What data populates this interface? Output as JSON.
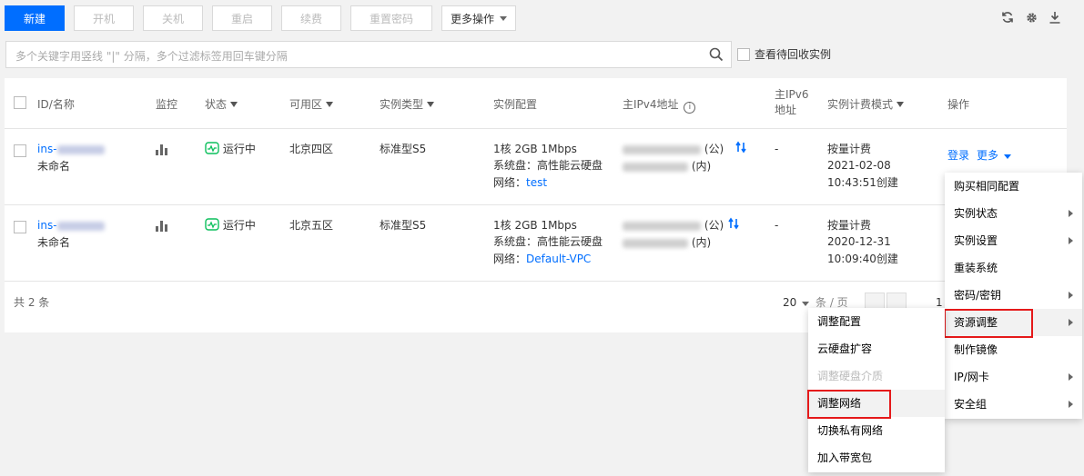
{
  "toolbar": {
    "new_label": "新建",
    "start_label": "开机",
    "stop_label": "关机",
    "restart_label": "重启",
    "renew_label": "续费",
    "reset_password_label": "重置密码",
    "more_actions_label": "更多操作"
  },
  "search": {
    "placeholder": "多个关键字用竖线 \"|\" 分隔，多个过滤标签用回车键分隔",
    "recycle_label": "查看待回收实例"
  },
  "table": {
    "headers": {
      "id_name": "ID/名称",
      "monitor": "监控",
      "status": "状态",
      "zone": "可用区",
      "instance_type": "实例类型",
      "config": "实例配置",
      "ipv4": "主IPv4地址",
      "ipv6_line1": "主IPv6",
      "ipv6_line2": "地址",
      "billing": "实例计费模式",
      "ops": "操作"
    },
    "rows": [
      {
        "id_prefix": "ins-",
        "name": "未命名",
        "status": "运行中",
        "zone": "北京四区",
        "type": "标准型S5",
        "config_spec": "1核 2GB 1Mbps",
        "config_disk": "系统盘：高性能云硬盘",
        "config_network_label": "网络：",
        "config_network": "test",
        "public_suffix": "(公)",
        "private_suffix": "(内)",
        "ipv6": "-",
        "billing_mode": "按量计费",
        "billing_date": "2021-02-08",
        "billing_time": "10:43:51创建",
        "op_login": "登录",
        "op_more": "更多"
      },
      {
        "id_prefix": "ins-",
        "name": "未命名",
        "status": "运行中",
        "zone": "北京五区",
        "type": "标准型S5",
        "config_spec": "1核 2GB 1Mbps",
        "config_disk": "系统盘：高性能云硬盘",
        "config_network_label": "网络：",
        "config_network": "Default-VPC",
        "public_suffix": "(公)",
        "private_suffix": "(内)",
        "ipv6": "-",
        "billing_mode": "按量计费",
        "billing_date": "2020-12-31",
        "billing_time": "10:09:40创建"
      }
    ],
    "footer": {
      "total": "共 2 条",
      "page_size": "20",
      "per_page": "条 / 页",
      "page_number": "1"
    }
  },
  "more_menu": {
    "items": [
      "购买相同配置",
      "实例状态",
      "实例设置",
      "重装系统",
      "密码/密钥",
      "资源调整",
      "制作镜像",
      "IP/网卡",
      "安全组"
    ]
  },
  "resource_submenu": {
    "items": [
      "调整配置",
      "云硬盘扩容",
      "调整硬盘介质",
      "调整网络",
      "切换私有网络",
      "加入带宽包"
    ]
  },
  "colors": {
    "primary": "#006eff",
    "running": "#0abf5b",
    "highlight": "#e5191a"
  }
}
